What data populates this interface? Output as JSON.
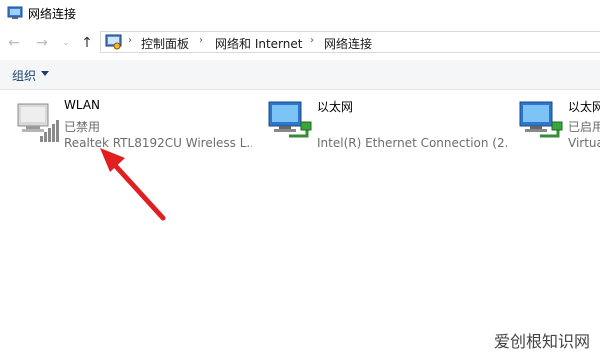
{
  "window": {
    "title": "网络连接",
    "app_icon": "network-connections-icon"
  },
  "nav": {
    "back_icon": "arrow-left-icon",
    "forward_icon": "arrow-right-icon",
    "recent_icon": "chevron-down-icon",
    "up_icon": "arrow-up-icon"
  },
  "breadcrumb": [
    "控制面板",
    "网络和 Internet",
    "网络连接"
  ],
  "toolbar": {
    "organize_label": "组织"
  },
  "connections": [
    {
      "name": "WLAN",
      "status": "已禁用",
      "device": "Realtek RTL8192CU Wireless L...",
      "icon": "wireless-adapter-disabled-icon"
    },
    {
      "name": "以太网",
      "status": "",
      "device": "Intel(R) Ethernet Connection (2...",
      "icon": "ethernet-adapter-icon"
    },
    {
      "name": "以太网",
      "status": "已启用",
      "device": "Virtua",
      "icon": "ethernet-adapter-icon"
    }
  ],
  "annotation": {
    "color": "#e02020"
  },
  "watermark": "爱创根知识网"
}
